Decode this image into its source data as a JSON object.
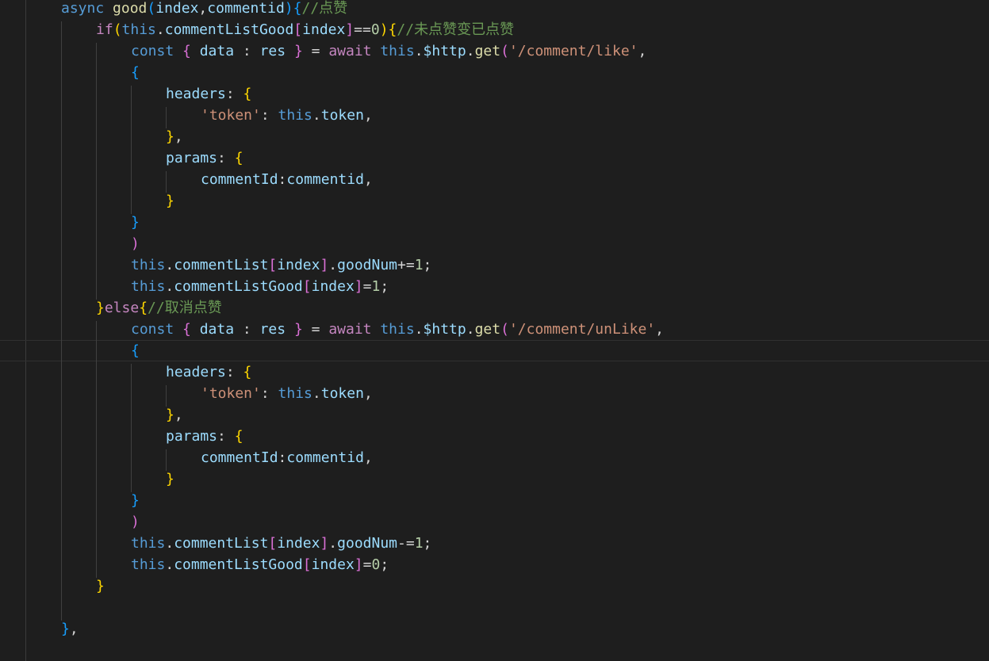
{
  "colors": {
    "background": "#1e1e1e",
    "keyword": "#569cd6",
    "control": "#c586c0",
    "function": "#dcdcaa",
    "variable": "#9cdcfe",
    "string": "#ce9178",
    "number": "#b5cea8",
    "comment": "#6a9955",
    "punctuation": "#d4d4d4",
    "bracket_level_1": "#ffd700",
    "bracket_level_2": "#da70d6",
    "bracket_level_3": "#179fff"
  },
  "current_line": 16,
  "lines": [
    {
      "indent": 1,
      "tokens": [
        [
          "kw",
          "async"
        ],
        [
          "op",
          " "
        ],
        [
          "fn",
          "good"
        ],
        [
          "b3",
          "("
        ],
        [
          "var",
          "index"
        ],
        [
          "op",
          ","
        ],
        [
          "var",
          "commentid"
        ],
        [
          "b3",
          ")"
        ],
        [
          "b3",
          "{"
        ],
        [
          "cmt",
          "//点赞"
        ]
      ]
    },
    {
      "indent": 2,
      "tokens": [
        [
          "ctl",
          "if"
        ],
        [
          "b1",
          "("
        ],
        [
          "kw",
          "this"
        ],
        [
          "op",
          "."
        ],
        [
          "var",
          "commentListGood"
        ],
        [
          "b2",
          "["
        ],
        [
          "var",
          "index"
        ],
        [
          "b2",
          "]"
        ],
        [
          "op",
          "=="
        ],
        [
          "num",
          "0"
        ],
        [
          "b1",
          ")"
        ],
        [
          "b1",
          "{"
        ],
        [
          "cmt",
          "//未点赞变已点赞"
        ]
      ]
    },
    {
      "indent": 3,
      "tokens": [
        [
          "kw",
          "const"
        ],
        [
          "op",
          " "
        ],
        [
          "b2",
          "{"
        ],
        [
          "op",
          " "
        ],
        [
          "var",
          "data"
        ],
        [
          "op",
          " : "
        ],
        [
          "var",
          "res"
        ],
        [
          "op",
          " "
        ],
        [
          "b2",
          "}"
        ],
        [
          "op",
          " = "
        ],
        [
          "ctl",
          "await"
        ],
        [
          "op",
          " "
        ],
        [
          "kw",
          "this"
        ],
        [
          "op",
          "."
        ],
        [
          "var",
          "$http"
        ],
        [
          "op",
          "."
        ],
        [
          "fn",
          "get"
        ],
        [
          "b2",
          "("
        ],
        [
          "str",
          "'/comment/like'"
        ],
        [
          "op",
          ","
        ]
      ]
    },
    {
      "indent": 3,
      "tokens": [
        [
          "b3",
          "{"
        ]
      ]
    },
    {
      "indent": 4,
      "tokens": [
        [
          "var",
          "headers"
        ],
        [
          "op",
          ": "
        ],
        [
          "b1",
          "{"
        ]
      ]
    },
    {
      "indent": 5,
      "tokens": [
        [
          "str",
          "'token'"
        ],
        [
          "op",
          ": "
        ],
        [
          "kw",
          "this"
        ],
        [
          "op",
          "."
        ],
        [
          "var",
          "token"
        ],
        [
          "op",
          ","
        ]
      ]
    },
    {
      "indent": 4,
      "tokens": [
        [
          "b1",
          "}"
        ],
        [
          "op",
          ","
        ]
      ]
    },
    {
      "indent": 4,
      "tokens": [
        [
          "var",
          "params"
        ],
        [
          "op",
          ": "
        ],
        [
          "b1",
          "{"
        ]
      ]
    },
    {
      "indent": 5,
      "tokens": [
        [
          "var",
          "commentId"
        ],
        [
          "op",
          ":"
        ],
        [
          "var",
          "commentid"
        ],
        [
          "op",
          ","
        ]
      ]
    },
    {
      "indent": 4,
      "tokens": [
        [
          "b1",
          "}"
        ]
      ]
    },
    {
      "indent": 3,
      "tokens": [
        [
          "b3",
          "}"
        ]
      ]
    },
    {
      "indent": 3,
      "tokens": [
        [
          "b2",
          ")"
        ]
      ]
    },
    {
      "indent": 3,
      "tokens": [
        [
          "kw",
          "this"
        ],
        [
          "op",
          "."
        ],
        [
          "var",
          "commentList"
        ],
        [
          "b2",
          "["
        ],
        [
          "var",
          "index"
        ],
        [
          "b2",
          "]"
        ],
        [
          "op",
          "."
        ],
        [
          "var",
          "goodNum"
        ],
        [
          "op",
          "+="
        ],
        [
          "num",
          "1"
        ],
        [
          "op",
          ";"
        ]
      ]
    },
    {
      "indent": 3,
      "tokens": [
        [
          "kw",
          "this"
        ],
        [
          "op",
          "."
        ],
        [
          "var",
          "commentListGood"
        ],
        [
          "b2",
          "["
        ],
        [
          "var",
          "index"
        ],
        [
          "b2",
          "]"
        ],
        [
          "op",
          "="
        ],
        [
          "num",
          "1"
        ],
        [
          "op",
          ";"
        ]
      ]
    },
    {
      "indent": 2,
      "tokens": [
        [
          "b1",
          "}"
        ],
        [
          "ctl",
          "else"
        ],
        [
          "b1",
          "{"
        ],
        [
          "cmt",
          "//取消点赞"
        ]
      ]
    },
    {
      "indent": 3,
      "tokens": [
        [
          "kw",
          "const"
        ],
        [
          "op",
          " "
        ],
        [
          "b2",
          "{"
        ],
        [
          "op",
          " "
        ],
        [
          "var",
          "data"
        ],
        [
          "op",
          " : "
        ],
        [
          "var",
          "res"
        ],
        [
          "op",
          " "
        ],
        [
          "b2",
          "}"
        ],
        [
          "op",
          " = "
        ],
        [
          "ctl",
          "await"
        ],
        [
          "op",
          " "
        ],
        [
          "kw",
          "this"
        ],
        [
          "op",
          "."
        ],
        [
          "var",
          "$http"
        ],
        [
          "op",
          "."
        ],
        [
          "fn",
          "get"
        ],
        [
          "b2",
          "("
        ],
        [
          "str",
          "'/comment/unLike'"
        ],
        [
          "op",
          ","
        ]
      ]
    },
    {
      "indent": 3,
      "tokens": [
        [
          "b3",
          "{"
        ]
      ]
    },
    {
      "indent": 4,
      "tokens": [
        [
          "var",
          "headers"
        ],
        [
          "op",
          ": "
        ],
        [
          "b1",
          "{"
        ]
      ]
    },
    {
      "indent": 5,
      "tokens": [
        [
          "str",
          "'token'"
        ],
        [
          "op",
          ": "
        ],
        [
          "kw",
          "this"
        ],
        [
          "op",
          "."
        ],
        [
          "var",
          "token"
        ],
        [
          "op",
          ","
        ]
      ]
    },
    {
      "indent": 4,
      "tokens": [
        [
          "b1",
          "}"
        ],
        [
          "op",
          ","
        ]
      ]
    },
    {
      "indent": 4,
      "tokens": [
        [
          "var",
          "params"
        ],
        [
          "op",
          ": "
        ],
        [
          "b1",
          "{"
        ]
      ]
    },
    {
      "indent": 5,
      "tokens": [
        [
          "var",
          "commentId"
        ],
        [
          "op",
          ":"
        ],
        [
          "var",
          "commentid"
        ],
        [
          "op",
          ","
        ]
      ]
    },
    {
      "indent": 4,
      "tokens": [
        [
          "b1",
          "}"
        ]
      ]
    },
    {
      "indent": 3,
      "tokens": [
        [
          "b3",
          "}"
        ]
      ]
    },
    {
      "indent": 3,
      "tokens": [
        [
          "b2",
          ")"
        ]
      ]
    },
    {
      "indent": 3,
      "tokens": [
        [
          "kw",
          "this"
        ],
        [
          "op",
          "."
        ],
        [
          "var",
          "commentList"
        ],
        [
          "b2",
          "["
        ],
        [
          "var",
          "index"
        ],
        [
          "b2",
          "]"
        ],
        [
          "op",
          "."
        ],
        [
          "var",
          "goodNum"
        ],
        [
          "op",
          "-="
        ],
        [
          "num",
          "1"
        ],
        [
          "op",
          ";"
        ]
      ]
    },
    {
      "indent": 3,
      "tokens": [
        [
          "kw",
          "this"
        ],
        [
          "op",
          "."
        ],
        [
          "var",
          "commentListGood"
        ],
        [
          "b2",
          "["
        ],
        [
          "var",
          "index"
        ],
        [
          "b2",
          "]"
        ],
        [
          "op",
          "="
        ],
        [
          "num",
          "0"
        ],
        [
          "op",
          ";"
        ]
      ]
    },
    {
      "indent": 2,
      "tokens": [
        [
          "b1",
          "}"
        ]
      ]
    },
    {
      "indent": 0,
      "tokens": []
    },
    {
      "indent": 1,
      "tokens": [
        [
          "b3",
          "}"
        ],
        [
          "op",
          ","
        ]
      ]
    }
  ]
}
